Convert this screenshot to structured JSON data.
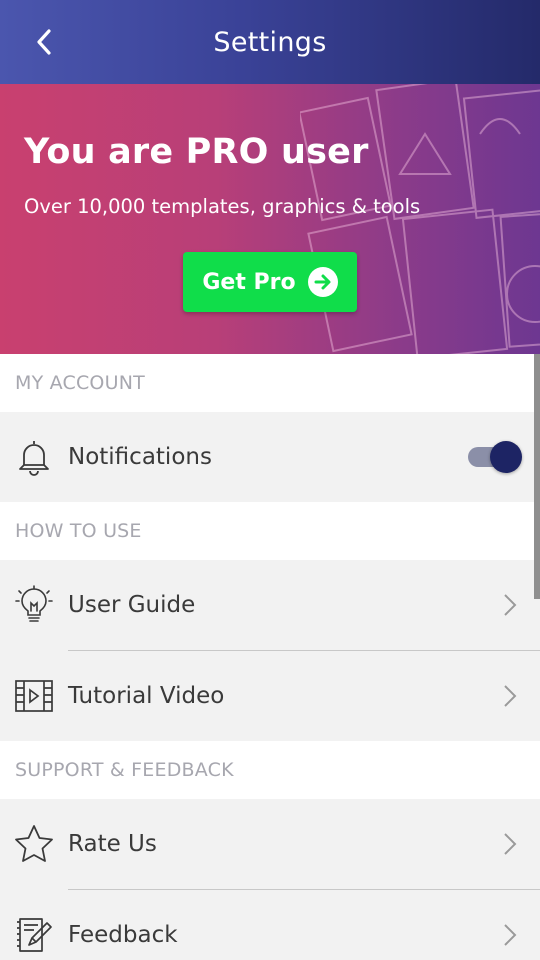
{
  "app_bar": {
    "title": "Settings",
    "back_icon": "back-arrow-icon"
  },
  "banner": {
    "title": "You are PRO user",
    "subtitle": "Over 10,000 templates, graphics & tools",
    "button_label": "Get Pro",
    "button_icon": "arrow-right-circle-icon",
    "colors": {
      "gradient_start": "#c9406f",
      "gradient_end": "#6d3791",
      "button": "#10dd4a"
    }
  },
  "sections": {
    "account": {
      "header": "MY ACCOUNT"
    },
    "how_to_use": {
      "header": "HOW TO USE"
    },
    "support": {
      "header": "SUPPORT & FEEDBACK"
    }
  },
  "items": {
    "notifications": {
      "label": "Notifications",
      "icon": "bell-icon",
      "toggle_on": true
    },
    "user_guide": {
      "label": "User Guide",
      "icon": "lightbulb-icon"
    },
    "tutorial_video": {
      "label": "Tutorial Video",
      "icon": "film-play-icon"
    },
    "rate_us": {
      "label": "Rate Us",
      "icon": "star-icon"
    },
    "feedback": {
      "label": "Feedback",
      "icon": "document-edit-icon"
    }
  },
  "theme": {
    "accent": "#1d2464",
    "app_bar_start": "#4b56ae",
    "app_bar_end": "#242a6a"
  }
}
